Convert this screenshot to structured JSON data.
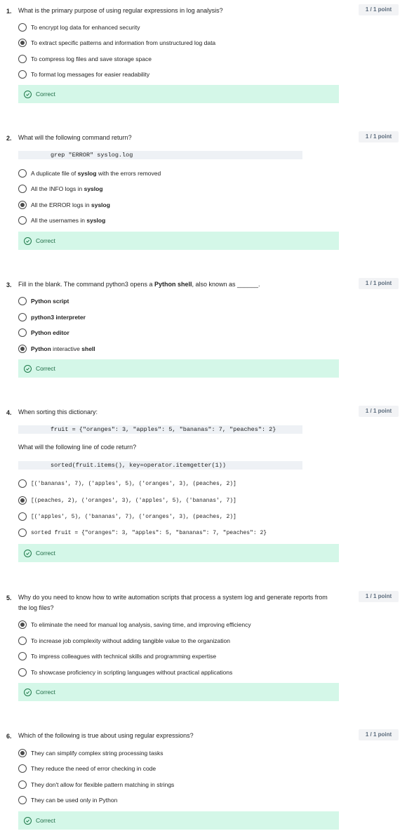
{
  "questions": [
    {
      "num": "1.",
      "text": "What is the primary purpose of using regular expressions in log analysis?",
      "points": "1 / 1 point",
      "options": [
        "To encrypt log data for enhanced security",
        "To extract specific patterns and information from unstructured log data",
        "To compress log files and save storage space",
        "To format log messages for easier readability"
      ],
      "selected": 1,
      "feedback": "Correct"
    },
    {
      "num": "2.",
      "text": "What will the following command return?",
      "points": "1 / 1 point",
      "code": "grep \"ERROR\" syslog.log",
      "options": [
        [
          "A duplicate file of ",
          "syslog",
          " with the errors removed"
        ],
        [
          "All the INFO logs in ",
          "syslog",
          ""
        ],
        [
          "All the ERROR logs in ",
          "syslog",
          ""
        ],
        [
          "All the usernames in ",
          "syslog",
          ""
        ]
      ],
      "selected": 2,
      "feedback": "Correct"
    },
    {
      "num": "3.",
      "text_parts": [
        "Fill in the blank. The command python3 opens a ",
        "Python shell",
        ", also known as ______."
      ],
      "points": "1 / 1 point",
      "options": [
        [
          "",
          "Python script",
          ""
        ],
        [
          "",
          "python3 interpreter",
          ""
        ],
        [
          "",
          "Python editor",
          ""
        ],
        [
          "",
          "Python",
          " interactive ",
          "shell"
        ]
      ],
      "selected": 3,
      "feedback": "Correct"
    },
    {
      "num": "4.",
      "text": "When sorting this dictionary:",
      "points": "1 / 1 point",
      "code": "fruit = {\"oranges\": 3, \"apples\": 5, \"bananas\": 7, \"peaches\": 2}",
      "subtext": "What will the following line of code return?",
      "code2": "sorted(fruit.items(), key=operator.itemgetter(1))",
      "options": [
        "[('bananas', 7), ('apples', 5), ('oranges', 3), (peaches, 2)]",
        "[(peaches, 2), ('oranges', 3), ('apples', 5), ('bananas', 7)]",
        "[('apples', 5), ('bananas', 7), ('oranges', 3), (peaches, 2)]",
        "sorted fruit = {\"oranges\": 3, \"apples\": 5, \"bananas\": 7, \"peaches\": 2}"
      ],
      "selected": 1,
      "feedback": "Correct"
    },
    {
      "num": "5.",
      "text": "Why do you need to know how to write automation scripts that process a system log and generate reports from the log files?",
      "points": "1 / 1 point",
      "options": [
        "To eliminate the need for manual log analysis, saving time, and improving efficiency",
        "To increase job complexity without adding tangible value to the organization",
        "To impress colleagues with technical skills and programming expertise",
        "To showcase proficiency in scripting languages without practical applications"
      ],
      "selected": 0,
      "feedback": "Correct"
    },
    {
      "num": "6.",
      "text": "Which of the following is true about using regular expressions?",
      "points": "1 / 1 point",
      "options": [
        "They can simplify complex string processing tasks",
        "They reduce the need of error checking in code",
        "They don't allow for flexible pattern matching in strings",
        "They can be used only in Python"
      ],
      "selected": 0,
      "feedback": "Correct"
    }
  ]
}
